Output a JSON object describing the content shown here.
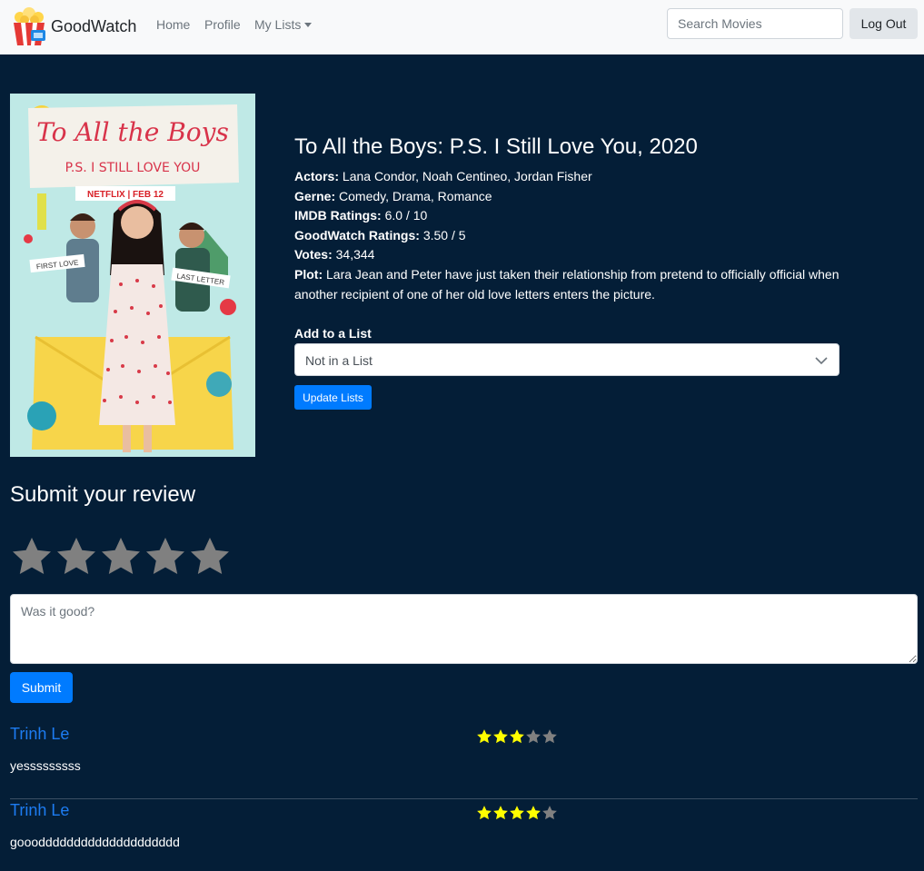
{
  "nav": {
    "brand": "GoodWatch",
    "home": "Home",
    "profile": "Profile",
    "my_lists": "My Lists",
    "search_placeholder": "Search Movies",
    "logout": "Log Out"
  },
  "movie": {
    "title": "To All the Boys: P.S. I Still Love You, 2020",
    "actors_label": "Actors:",
    "actors": "Lana Condor, Noah Centineo, Jordan Fisher",
    "genre_label": "Gerne:",
    "genre": "Comedy, Drama, Romance",
    "imdb_label": "IMDB Ratings:",
    "imdb": "6.0 / 10",
    "goodwatch_label": "GoodWatch Ratings:",
    "goodwatch": "3.50 / 5",
    "votes_label": "Votes:",
    "votes": "34,344",
    "plot_label": "Plot:",
    "plot": "Lara Jean and Peter have just taken their relationship from pretend to officially official when another recipient of one of her old love letters enters the picture.",
    "poster": {
      "title_line1": "To All the Boys",
      "title_line2": "P.S. I STILL LOVE YOU",
      "badge": "NETFLIX | FEB 12",
      "tag_left": "FIRST LOVE",
      "tag_right": "LAST LETTER"
    }
  },
  "lists": {
    "label": "Add to a List",
    "selected": "Not in a List",
    "update_button": "Update Lists"
  },
  "review_form": {
    "heading": "Submit your review",
    "placeholder": "Was it good?",
    "submit": "Submit",
    "rating": 0
  },
  "reviews": [
    {
      "author": "Trinh Le",
      "rating": 3,
      "text": "yesssssssss"
    },
    {
      "author": "Trinh Le",
      "rating": 4,
      "text": "gooodddddddddddddddddddd"
    }
  ],
  "colors": {
    "background": "#041e37",
    "accent": "#007bff",
    "star_filled": "#ffff00",
    "star_empty": "#808080"
  }
}
